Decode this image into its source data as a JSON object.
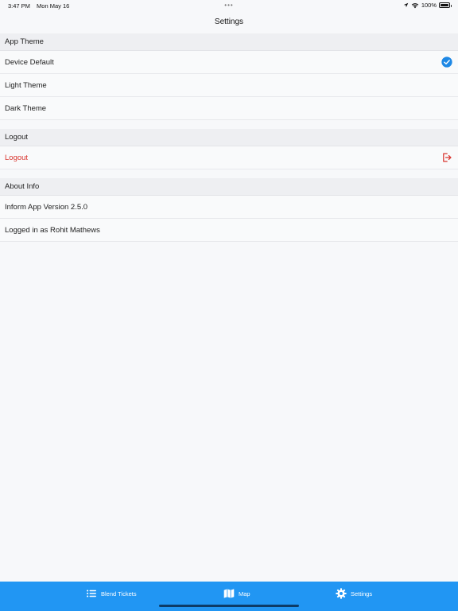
{
  "status_bar": {
    "time": "3:47 PM",
    "date": "Mon May 16",
    "battery": "100%"
  },
  "nav": {
    "title": "Settings"
  },
  "sections": {
    "theme": {
      "header": "App Theme",
      "items": [
        {
          "label": "Device Default",
          "selected": true
        },
        {
          "label": "Light Theme",
          "selected": false
        },
        {
          "label": "Dark Theme",
          "selected": false
        }
      ]
    },
    "logout": {
      "header": "Logout",
      "item_label": "Logout"
    },
    "about": {
      "header": "About Info",
      "items": [
        {
          "label": "Inform App Version 2.5.0"
        },
        {
          "label": "Logged in as Rohit Mathews"
        }
      ]
    }
  },
  "tab_bar": {
    "tabs": [
      {
        "label": "Blend Tickets",
        "icon": "list-icon"
      },
      {
        "label": "Map",
        "icon": "map-icon"
      },
      {
        "label": "Settings",
        "icon": "gear-icon"
      }
    ]
  },
  "colors": {
    "accent": "#2196f3",
    "logout": "#d9352f",
    "check": "#1e88e5"
  }
}
